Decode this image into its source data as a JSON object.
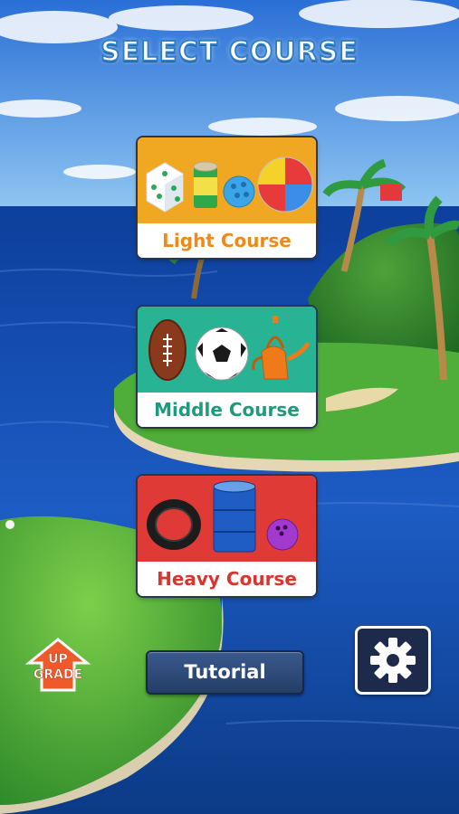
{
  "screen_title": "SELECT COURSE",
  "courses": [
    {
      "label": "Light Course",
      "items": [
        "dice-icon",
        "can-icon",
        "wiffle-ball-icon",
        "beach-ball-icon"
      ]
    },
    {
      "label": "Middle Course",
      "items": [
        "football-icon",
        "soccer-ball-icon",
        "kettle-icon"
      ]
    },
    {
      "label": "Heavy Course",
      "items": [
        "tire-icon",
        "oil-drum-icon",
        "bowling-ball-icon"
      ]
    }
  ],
  "buttons": {
    "tutorial": "Tutorial",
    "upgrade_line1": "UP",
    "upgrade_line2": "GRADE",
    "settings_icon": "gear-icon"
  },
  "colors": {
    "light": "#f0a823",
    "middle": "#27b394",
    "heavy": "#e03a36",
    "button": "#243d66"
  }
}
